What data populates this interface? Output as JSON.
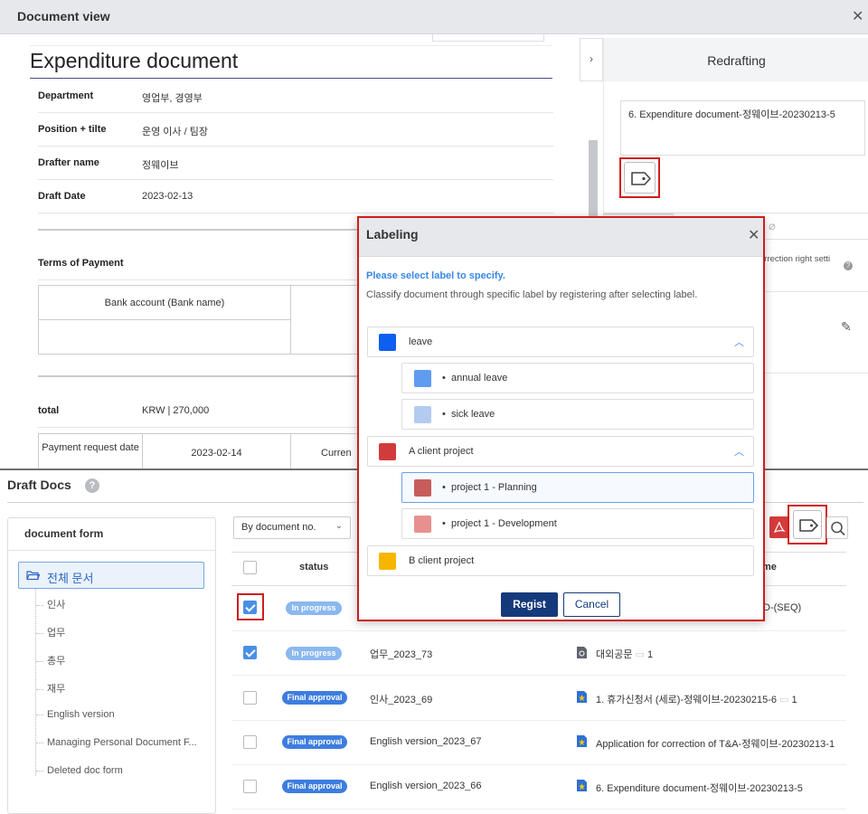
{
  "window": {
    "title": "Document view"
  },
  "document": {
    "title": "Expenditure document",
    "fields": [
      {
        "label": "Department",
        "value": "영업부, 경영부"
      },
      {
        "label": "Position + tilte",
        "value": "운영 이사 / 팀장"
      },
      {
        "label": "Drafter name",
        "value": "정웨이브"
      },
      {
        "label": "Draft Date",
        "value": "2023-02-13"
      }
    ],
    "terms_label": "Terms of Payment",
    "bank_header": "Bank account (Bank name)",
    "total_label": "total",
    "total_value": "KRW | 270,000",
    "payment_request_label": "Payment request date",
    "payment_request_value": "2023-02-14",
    "currency_label": "Curren"
  },
  "right_panel": {
    "title": "Redrafting",
    "redraft_text": "6. Expenditure document-정웨이브-20230213-5",
    "correction_text": "orrection right setti"
  },
  "modal": {
    "title": "Labeling",
    "instruction_title": "Please select label to specify.",
    "instruction_text": "Classify document through specific label by registering after selecting label.",
    "labels": [
      {
        "name": "leave",
        "color": "#0d5ff0",
        "level": 0
      },
      {
        "name": "annual leave",
        "color": "#5f9cf0",
        "level": 1
      },
      {
        "name": "sick leave",
        "color": "#b3cbf0",
        "level": 1
      },
      {
        "name": "A client project",
        "color": "#d23b3b",
        "level": 0
      },
      {
        "name": "project 1 - Planning",
        "color": "#c85c5c",
        "level": 1,
        "selected": true
      },
      {
        "name": "project 1 - Development",
        "color": "#e89090",
        "level": 1
      },
      {
        "name": "B client project",
        "color": "#f7b500",
        "level": 0
      }
    ],
    "regist_label": "Regist",
    "cancel_label": "Cancel"
  },
  "draft_docs": {
    "title": "Draft Docs",
    "help": "?",
    "form_panel_title": "document form",
    "root_folder": "전체 문서",
    "folders": [
      "인사",
      "업무",
      "총무",
      "재무",
      "English version",
      "Managing Personal Document F...",
      "Deleted doc form"
    ],
    "sort_select": "By document no.",
    "columns": {
      "status": "status",
      "name": "me"
    },
    "rows": [
      {
        "checked": true,
        "status": "In progress",
        "status_type": "prog",
        "doc_no": "",
        "name": "D-(SEQ)",
        "comments": ""
      },
      {
        "checked": true,
        "status": "In progress",
        "status_type": "prog",
        "doc_no": "업무_2023_73",
        "name": "대외공문",
        "comments": "1"
      },
      {
        "checked": false,
        "status": "Final approval",
        "status_type": "fin",
        "doc_no": "인사_2023_69",
        "name": "1. 휴가신청서 (세로)-정웨이브-20230215-6",
        "comments": "1"
      },
      {
        "checked": false,
        "status": "Final approval",
        "status_type": "fin",
        "doc_no": "English version_2023_67",
        "name": "Application for correction of T&A-정웨이브-20230213-1",
        "comments": ""
      },
      {
        "checked": false,
        "status": "Final approval",
        "status_type": "fin",
        "doc_no": "English version_2023_66",
        "name": "6. Expenditure document-정웨이브-20230213-5",
        "comments": ""
      }
    ]
  }
}
